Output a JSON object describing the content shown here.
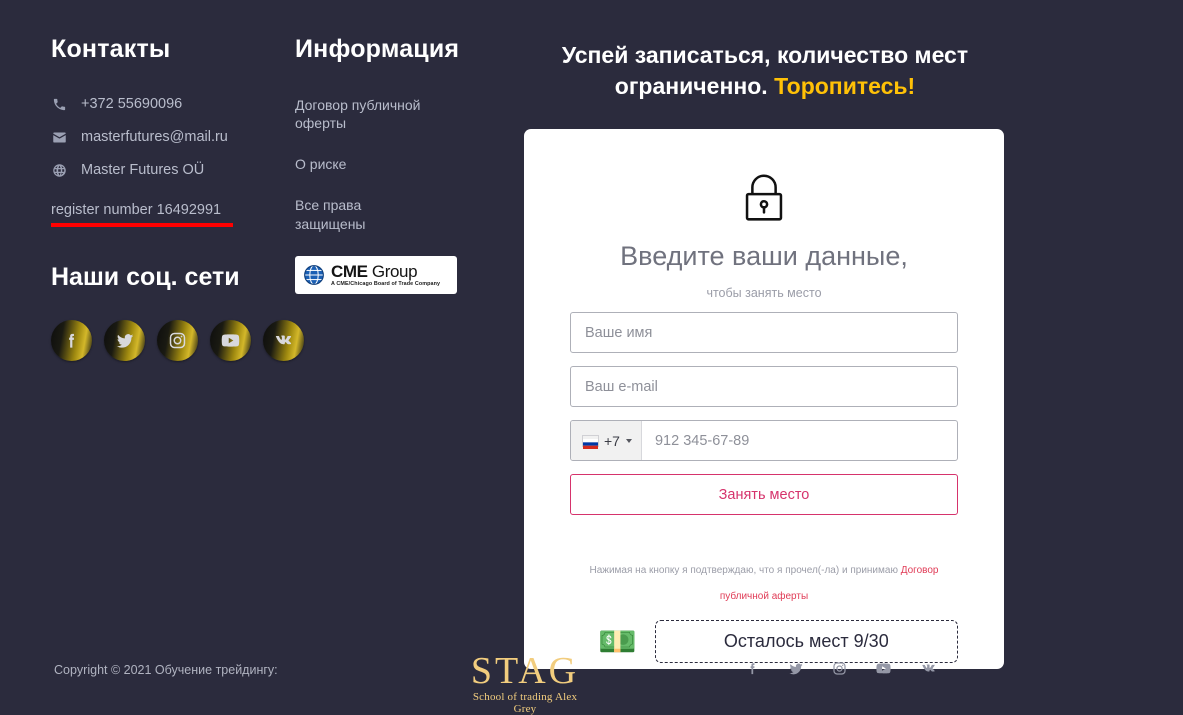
{
  "contacts": {
    "title": "Контакты",
    "items": [
      {
        "icon": "phone-icon",
        "text": "+372 55690096"
      },
      {
        "icon": "envelope-icon",
        "text": "masterfutures@mail.ru"
      },
      {
        "icon": "globe-icon",
        "text": "Master Futures OÜ"
      }
    ],
    "register": "register number 16492991",
    "underline_color": "#ff0000"
  },
  "social": {
    "title": "Наши соц. сети",
    "items": [
      {
        "name": "facebook",
        "label": "Facebook"
      },
      {
        "name": "twitter",
        "label": "Twitter"
      },
      {
        "name": "instagram",
        "label": "Instagram"
      },
      {
        "name": "youtube",
        "label": "YouTube"
      },
      {
        "name": "vk",
        "label": "VK"
      }
    ]
  },
  "info": {
    "title": "Информация",
    "links": [
      "Договор публичной оферты",
      "О риске",
      "Все права защищены"
    ],
    "cme": {
      "bold": "CME",
      "light": " Group",
      "tagline": "A CME/Chicago Board of Trade Company"
    }
  },
  "headline": {
    "line1": "Успей записаться, количество мест",
    "line2_plain": "ограниченно. ",
    "line2_accent": "Торопитесь!",
    "accent_color": "#ffc107"
  },
  "form": {
    "lock_icon": "lock-icon",
    "title": "Введите ваши данные,",
    "subtitle": "чтобы занять место",
    "name_placeholder": "Ваше имя",
    "name_value": "",
    "email_placeholder": "Ваш e-mail",
    "email_value": "",
    "phone_code": "+7",
    "phone_placeholder": "912 345-67-89",
    "phone_value": "",
    "submit_label": "Занять место",
    "submit_color": "#d6336c",
    "consent_text": "Нажимая на кнопку я подтверждаю, что я прочел(-ла) и принимаю ",
    "consent_link": "Договор публичной аферты",
    "consent_link_color": "#e03b56",
    "money_emoji": "💵",
    "seats_text": "Осталось мест 9/30"
  },
  "footer": {
    "copyright": "Copyright © 2021 Обучение трейдингу:",
    "logo_word": "STAG",
    "logo_sub": "School of trading Alex Grey",
    "logo_color": "#f2cd7e",
    "social": [
      {
        "name": "facebook",
        "label": "Facebook"
      },
      {
        "name": "twitter",
        "label": "Twitter"
      },
      {
        "name": "instagram",
        "label": "Instagram"
      },
      {
        "name": "youtube",
        "label": "YouTube"
      },
      {
        "name": "vk",
        "label": "VK"
      }
    ]
  },
  "theme": {
    "background": "#2b2b3d",
    "card_background": "#ffffff"
  }
}
